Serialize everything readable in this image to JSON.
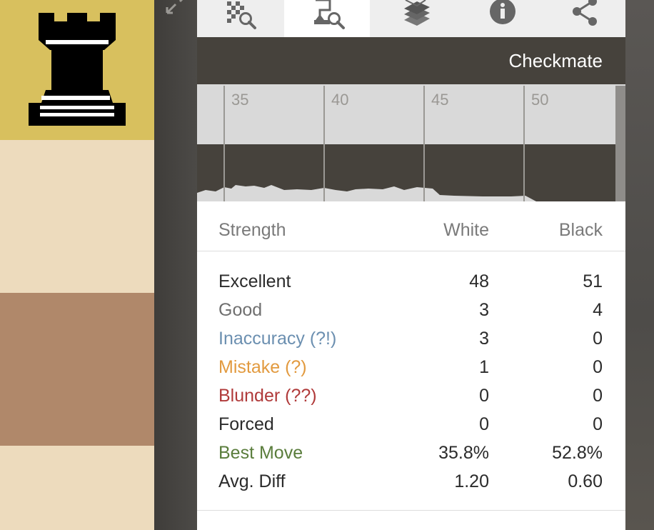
{
  "status": {
    "text": "Checkmate"
  },
  "tabs": [
    {
      "icon": "board-analysis-icon",
      "active": false
    },
    {
      "icon": "analysis-search-icon",
      "active": true
    },
    {
      "icon": "book-stack-icon",
      "active": false
    },
    {
      "icon": "info-icon",
      "active": false
    },
    {
      "icon": "share-icon",
      "active": false
    }
  ],
  "board": {
    "piece_icon": "black-rook-icon",
    "colors": {
      "highlight": "#d8c05e",
      "light": "#eddbbd",
      "dark": "#b0886a"
    }
  },
  "chart_data": {
    "type": "area",
    "x_tick_labels": [
      "35",
      "40",
      "45",
      "50"
    ],
    "colors": {
      "background": "#d9d9d9",
      "band": "#46423c",
      "area": "#d9d9d9"
    }
  },
  "table": {
    "headers": {
      "label": "Strength",
      "white": "White",
      "black": "Black"
    },
    "rows": [
      {
        "label": "Excellent",
        "white": "48",
        "black": "51",
        "color": "#2b2b2b"
      },
      {
        "label": "Good",
        "white": "3",
        "black": "4",
        "color": "#6f6f6f"
      },
      {
        "label": "Inaccuracy (?!)",
        "white": "3",
        "black": "0",
        "color": "#6b8fb0"
      },
      {
        "label": "Mistake (?)",
        "white": "1",
        "black": "0",
        "color": "#e29a3f"
      },
      {
        "label": "Blunder (??)",
        "white": "0",
        "black": "0",
        "color": "#b03a3a"
      },
      {
        "label": "Forced",
        "white": "0",
        "black": "0",
        "color": "#2b2b2b"
      },
      {
        "label": "Best Move",
        "white": "35.8%",
        "black": "52.8%",
        "color": "#5a7d3c"
      },
      {
        "label": "Avg. Diff",
        "white": "1.20",
        "black": "0.60",
        "color": "#2b2b2b"
      }
    ]
  }
}
